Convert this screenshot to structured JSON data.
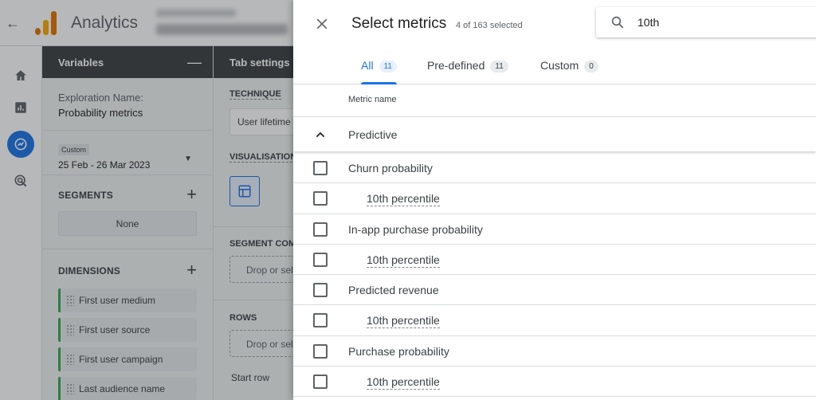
{
  "app": {
    "title": "Analytics",
    "back_icon": "arrow-back-icon"
  },
  "variables_panel": {
    "header": "Variables",
    "exploration_name_label": "Exploration Name:",
    "exploration_name_value": "Probability metrics",
    "date_chip": "Custom",
    "date_range": "25 Feb - 26 Mar 2023",
    "segments_title": "SEGMENTS",
    "segments_none": "None",
    "dimensions_title": "DIMENSIONS",
    "dimensions": [
      "First user medium",
      "First user source",
      "First user campaign",
      "Last audience name"
    ]
  },
  "tab_settings": {
    "header": "Tab settings",
    "technique_label": "TECHNIQUE",
    "technique_value": "User lifetime",
    "visualisation_label": "VISUALISATION",
    "segment_label": "SEGMENT COMPARISONS",
    "segment_drop": "Drop or select segment",
    "rows_label": "ROWS",
    "rows_drop": "Drop or select dimension",
    "start_row": "Start row"
  },
  "metrics_sheet": {
    "title": "Select metrics",
    "count": "4 of 163 selected",
    "search_value": "10th",
    "tabs": [
      {
        "label": "All",
        "count": "11"
      },
      {
        "label": "Pre-defined",
        "count": "11"
      },
      {
        "label": "Custom",
        "count": "0"
      }
    ],
    "column_header": "Metric name",
    "group": "Predictive",
    "rows": [
      {
        "label": "Churn probability"
      },
      {
        "label": "10th percentile"
      },
      {
        "label": "In-app purchase probability"
      },
      {
        "label": "10th percentile"
      },
      {
        "label": "Predicted revenue"
      },
      {
        "label": "10th percentile"
      },
      {
        "label": "Purchase probability"
      },
      {
        "label": "10th percentile"
      }
    ]
  },
  "colors": {
    "accent": "#1a73e8",
    "dimension_marker": "#34a853",
    "logo_orange": "#e37400",
    "logo_yellow": "#f9ab00",
    "panel_header": "#3c4043"
  }
}
